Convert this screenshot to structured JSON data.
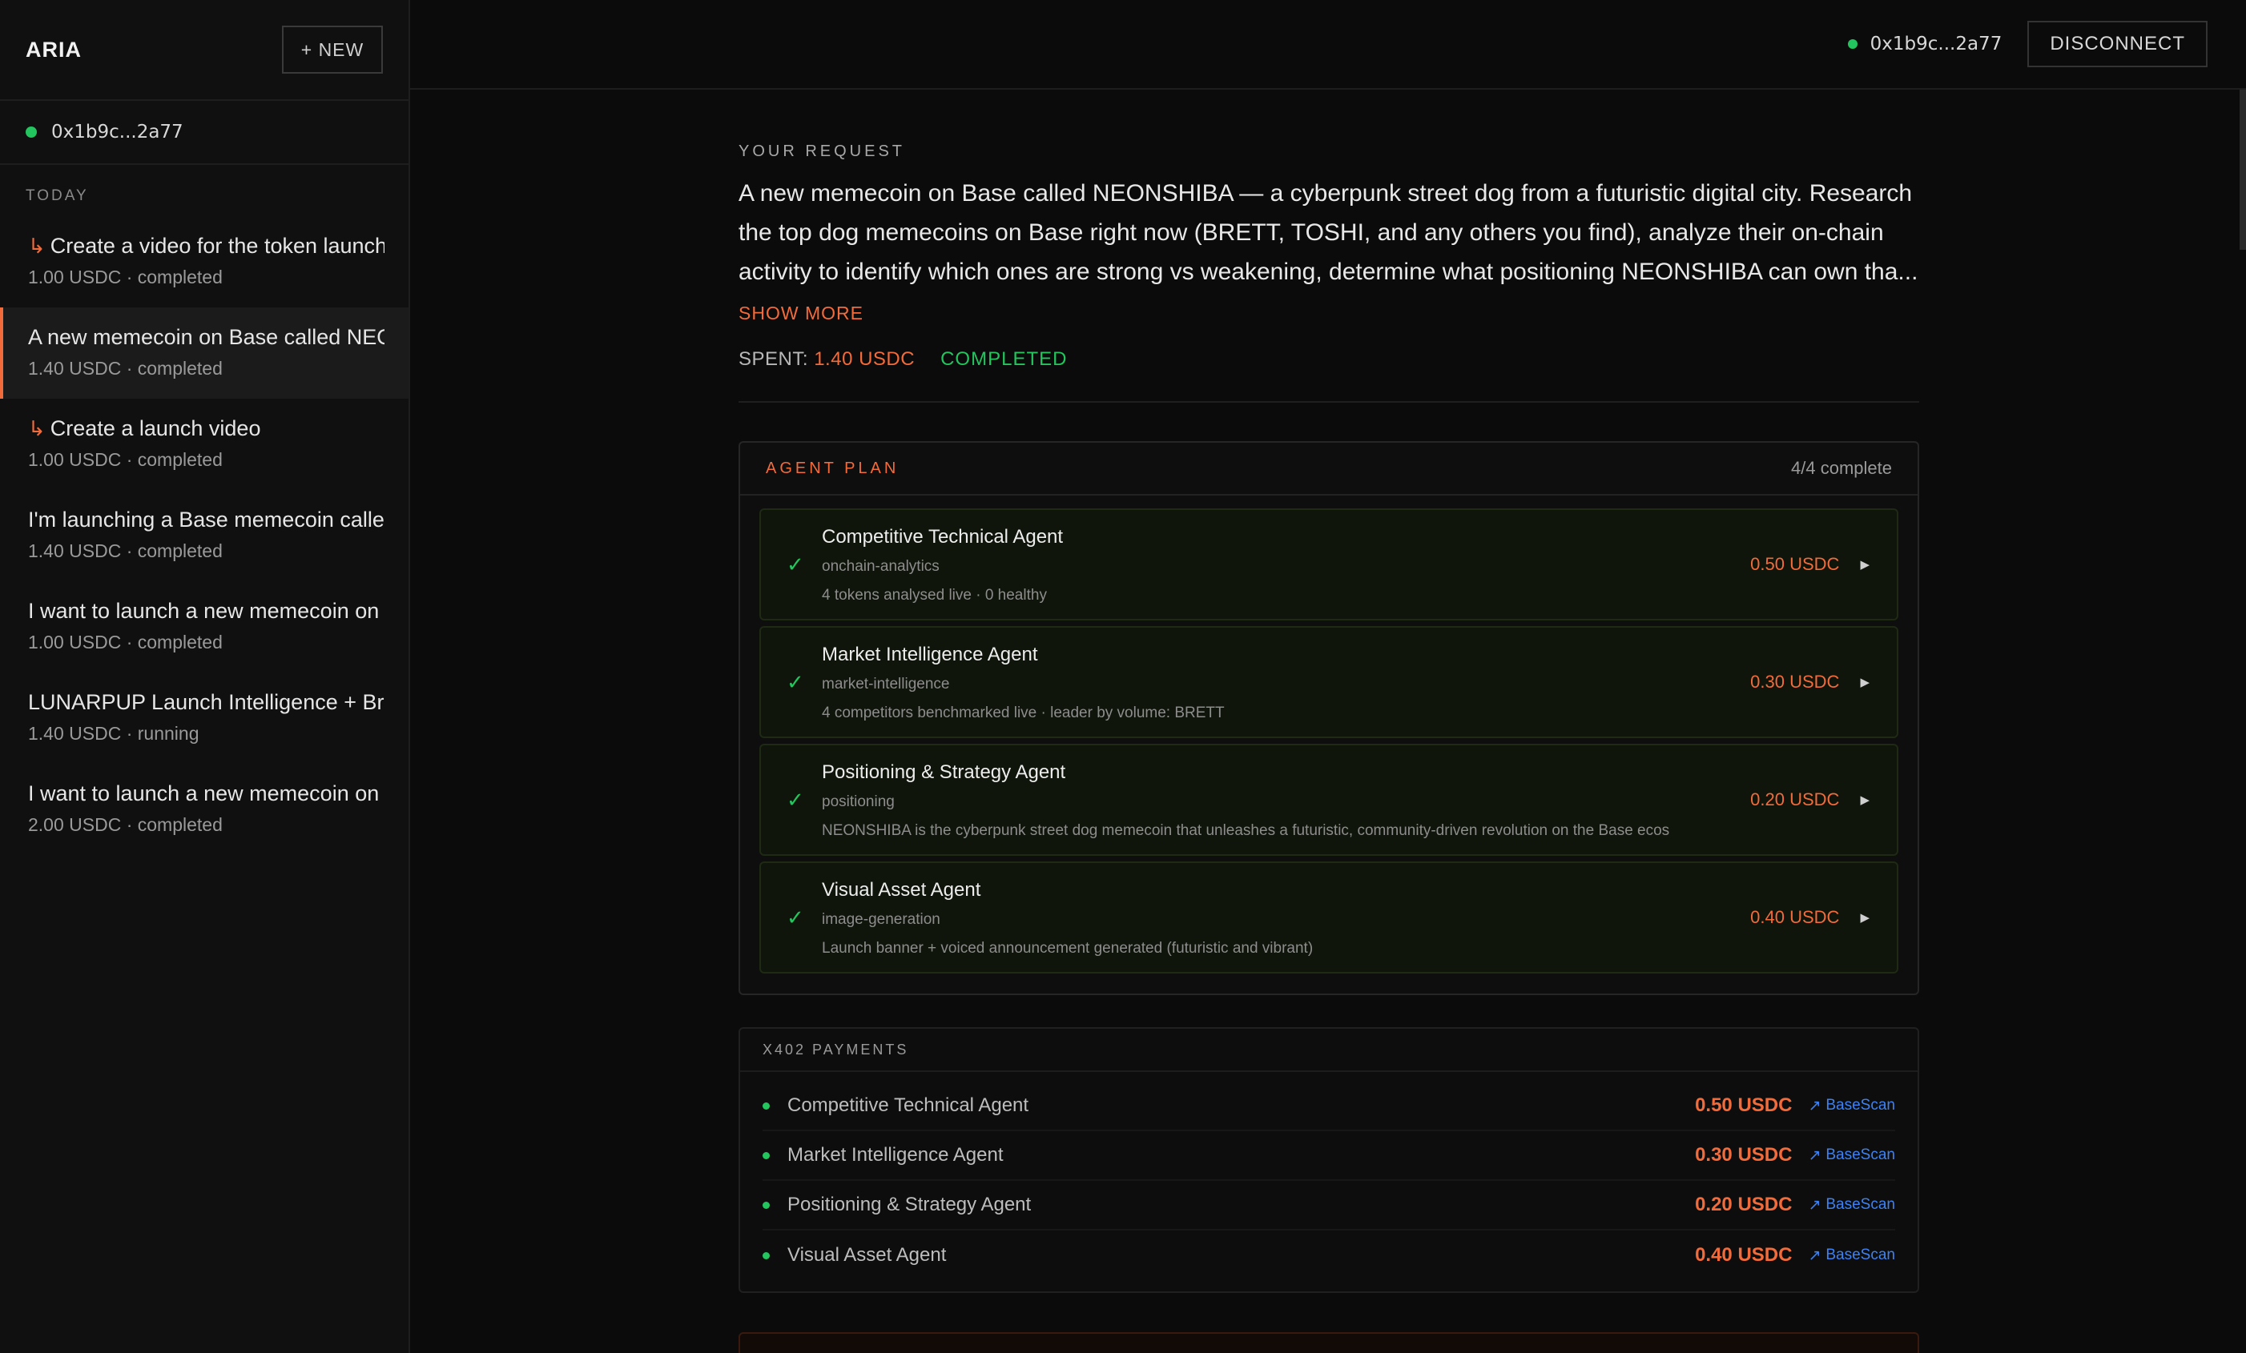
{
  "sidebar": {
    "brand": "ARIA",
    "new_button": "+ NEW",
    "wallet_address": "0x1b9c...2a77",
    "section_label": "TODAY",
    "conversations": [
      {
        "title": "Create a video for the token launch",
        "meta": "1.00 USDC · completed",
        "sub_icon": "↳"
      },
      {
        "title": "A new memecoin on Base called NEONSHIBA",
        "meta": "1.40 USDC · completed"
      },
      {
        "title": "Create a launch video",
        "meta": "1.00 USDC · completed",
        "sub_icon": "↳"
      },
      {
        "title": "I'm launching a Base memecoin called",
        "meta": "1.40 USDC · completed"
      },
      {
        "title": "I want to launch a new memecoin on",
        "meta": "1.00 USDC · completed"
      },
      {
        "title": "LUNARPUP Launch Intelligence + Brand",
        "meta": "1.40 USDC · running"
      },
      {
        "title": "I want to launch a new memecoin on",
        "meta": "2.00 USDC · completed"
      }
    ]
  },
  "topbar": {
    "wallet_address": "0x1b9c...2a77",
    "disconnect_label": "DISCONNECT"
  },
  "request": {
    "label": "YOUR REQUEST",
    "text": "A new memecoin on Base called NEONSHIBA — a cyberpunk street dog from a futuristic digital city. Research the top dog memecoins on Base right now (BRETT, TOSHI, and any others you find), analyze their on-chain activity to identify which ones are strong vs weakening, determine what positioning NEONSHIBA can own tha...",
    "show_more": "SHOW MORE",
    "spent_label": "SPENT:",
    "spent_value": "1.40 USDC",
    "status": "COMPLETED"
  },
  "plan": {
    "title": "AGENT PLAN",
    "progress": "4/4 complete",
    "agents": [
      {
        "name": "Competitive Technical Agent",
        "tag": "onchain-analytics",
        "desc": "4 tokens analysed live · 0 healthy",
        "price": "0.50 USDC"
      },
      {
        "name": "Market Intelligence Agent",
        "tag": "market-intelligence",
        "desc": "4 competitors benchmarked live · leader by volume: BRETT",
        "price": "0.30 USDC"
      },
      {
        "name": "Positioning & Strategy Agent",
        "tag": "positioning",
        "desc": "NEONSHIBA is the cyberpunk street dog memecoin that unleashes a futuristic, community-driven revolution on the Base ecos",
        "price": "0.20 USDC"
      },
      {
        "name": "Visual Asset Agent",
        "tag": "image-generation",
        "desc": "Launch banner + voiced announcement generated (futuristic and vibrant)",
        "price": "0.40 USDC"
      }
    ]
  },
  "payments": {
    "title": "X402 PAYMENTS",
    "link_label": "BaseScan",
    "rows": [
      {
        "name": "Competitive Technical Agent",
        "amount": "0.50 USDC"
      },
      {
        "name": "Market Intelligence Agent",
        "amount": "0.30 USDC"
      },
      {
        "name": "Positioning & Strategy Agent",
        "amount": "0.20 USDC"
      },
      {
        "name": "Visual Asset Agent",
        "amount": "0.40 USDC"
      }
    ]
  },
  "colors": {
    "accent": "#f26b3a",
    "success": "#22c55e",
    "link": "#3b82f6",
    "background": "#0b0b0b"
  }
}
